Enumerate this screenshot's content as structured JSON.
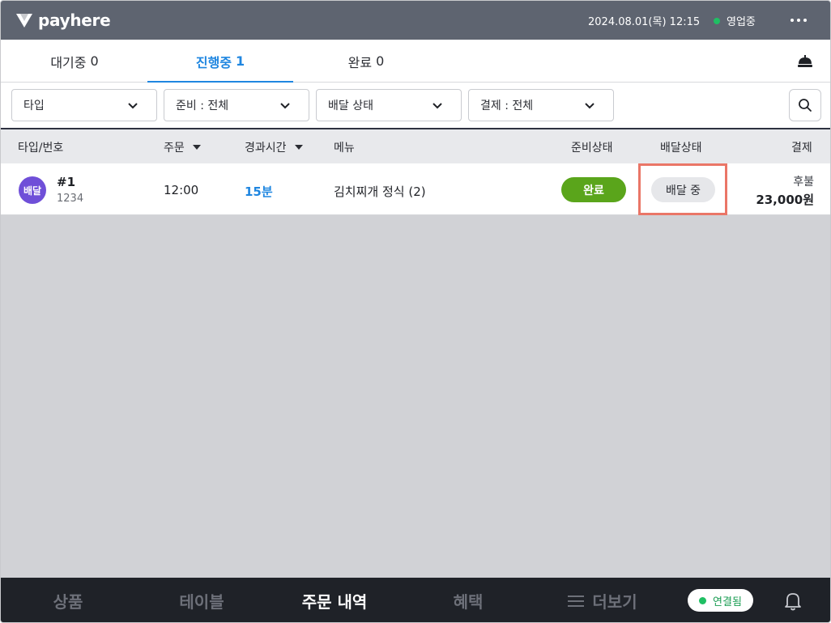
{
  "app": {
    "brand": "payhere",
    "datetime": "2024.08.01(목) 12:15",
    "store_status": "영업중",
    "colors": {
      "header_bg": "#5e6470",
      "accent": "#1f86e0",
      "prep_done": "#5aa51b",
      "delivery_type": "#6f4fd8",
      "highlight": "#ea7667",
      "online": "#1fbf63"
    }
  },
  "tabs": [
    {
      "label": "대기중",
      "count": "0",
      "active": false
    },
    {
      "label": "진행중",
      "count": "1",
      "active": true
    },
    {
      "label": "완료",
      "count": "0",
      "active": false
    }
  ],
  "filters": {
    "type": "타입",
    "prep": "준비 : 전체",
    "delivery": "배달 상태",
    "payment": "결제 : 전체"
  },
  "table": {
    "headers": {
      "type_no": "타입/번호",
      "order": "주문",
      "elapsed": "경과시간",
      "menu": "메뉴",
      "prep_status": "준비상태",
      "delivery_status": "배달상태",
      "payment": "결제"
    },
    "rows": [
      {
        "type_badge": "배달",
        "order_no": "#1",
        "order_sub": "1234",
        "time": "12:00",
        "elapsed": "15분",
        "menu": "김치찌개 정식 (2)",
        "prep_status": "완료",
        "delivery_status": "배달 중",
        "pay_type": "후불",
        "amount": "23,000원"
      }
    ]
  },
  "bottom_nav": {
    "items": [
      "상품",
      "테이블",
      "주문 내역",
      "혜택",
      "더보기"
    ],
    "active": "주문 내역",
    "connection": "연결됨"
  },
  "icons": [
    "logo-icon",
    "more-icon",
    "service-bell-icon",
    "chevron-down-icon",
    "search-icon",
    "sort-caret-icon",
    "menu-icon",
    "notification-bell-icon"
  ]
}
